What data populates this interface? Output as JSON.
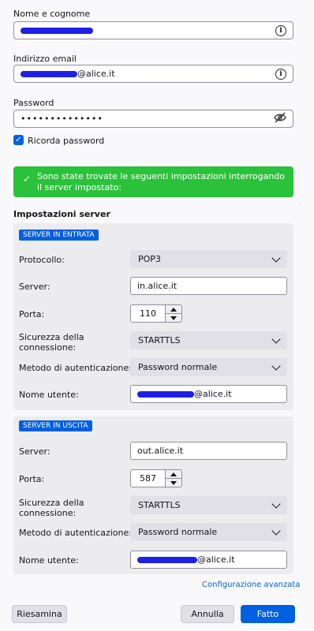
{
  "account": {
    "name_label": "Nome e cognome",
    "email_label": "Indirizzo email",
    "email_suffix": "@alice.it",
    "password_label": "Password",
    "password_mask": "••••••••••••••",
    "remember_label": "Ricorda password",
    "remember_checked": true
  },
  "banner": {
    "text": "Sono state trovate le seguenti impostazioni interrogando il server impostato:",
    "color": "#2ac23a"
  },
  "server_settings": {
    "heading": "Impostazioni server",
    "incoming": {
      "badge": "SERVER IN ENTRATA",
      "protocol_label": "Protocollo:",
      "protocol_value": "POP3",
      "server_label": "Server:",
      "server_value": "in.alice.it",
      "port_label": "Porta:",
      "port_value": "110",
      "security_label_1": "Sicurezza della",
      "security_label_2": "connessione:",
      "security_value": "STARTTLS",
      "auth_label": "Metodo di autenticazione:",
      "auth_value": "Password normale",
      "user_label": "Nome utente:",
      "user_suffix": "@alice.it"
    },
    "outgoing": {
      "badge": "SERVER IN USCITA",
      "server_label": "Server:",
      "server_value": "out.alice.it",
      "port_label": "Porta:",
      "port_value": "587",
      "security_label_1": "Sicurezza della",
      "security_label_2": "connessione:",
      "security_value": "STARTTLS",
      "auth_label": "Metodo di autenticazione:",
      "auth_value": "Password normale",
      "user_label": "Nome utente:",
      "user_suffix": "@alice.it"
    }
  },
  "advanced_link": "Configurazione avanzata",
  "buttons": {
    "review": "Riesamina",
    "cancel": "Annulla",
    "done": "Fatto"
  },
  "colors": {
    "accent": "#0061e0",
    "redaction": "#1f1fe6"
  },
  "icons": {
    "info": "info-icon",
    "visibility": "eye-slash-icon",
    "check": "checkmark-icon",
    "dropdown": "chevron-down-icon"
  }
}
